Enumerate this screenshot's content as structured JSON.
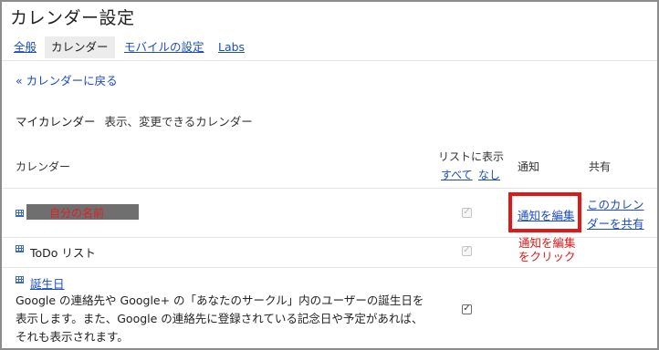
{
  "page": {
    "title": "カレンダー設定"
  },
  "tabs": [
    {
      "label": "全般"
    },
    {
      "label": "カレンダー"
    },
    {
      "label": "モバイルの設定"
    },
    {
      "label": "Labs"
    }
  ],
  "back_link": "« カレンダーに戻る",
  "section": {
    "title": "マイカレンダー",
    "subtitle": "表示、変更できるカレンダー"
  },
  "table": {
    "col_calendar": "カレンダー",
    "col_list_show": "リストに表示",
    "col_list_all": "すべて",
    "col_list_none": "なし",
    "col_notify": "通知",
    "col_share": "共有"
  },
  "rows": [
    {
      "name": "自分の名前",
      "list_checked": true,
      "list_enabled": false,
      "notify_label": "通知を編集",
      "share_label": "このカレンダーを共有"
    },
    {
      "name": "ToDo リスト",
      "list_checked": true,
      "list_enabled": false
    },
    {
      "name": "誕生日",
      "description": "Google の連絡先や Google+ の「あなたのサークル」内のユーザーの誕生日を表示します。また、Google の連絡先に登録されている記念日や予定があれば、それも表示されます。",
      "list_checked": true,
      "list_enabled": true
    }
  ],
  "annotation": {
    "text": "通知を編集\nをクリック",
    "color": "#e01818"
  },
  "colors": {
    "link": "#1a4cc4",
    "highlight": "#e01818"
  }
}
